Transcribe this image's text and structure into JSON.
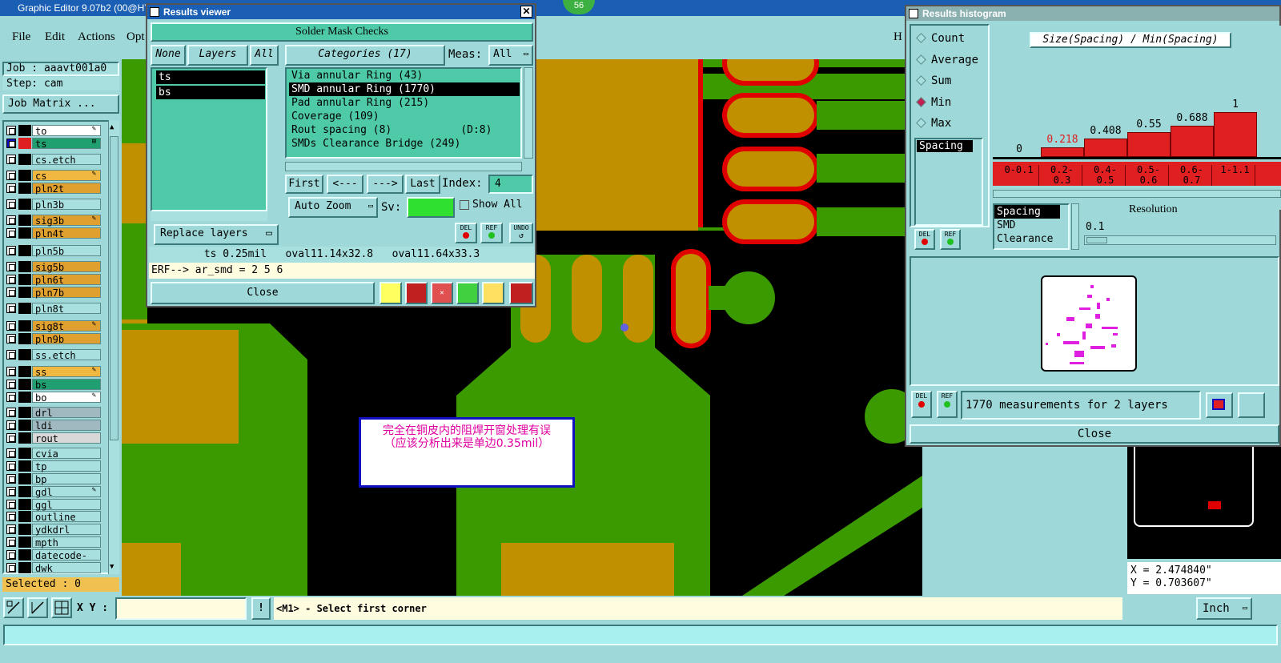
{
  "app": {
    "title": "Graphic Editor 9.07b2 (00@HY",
    "badge": "56"
  },
  "menu": {
    "file": "File",
    "edit": "Edit",
    "actions": "Actions",
    "options": "Opt",
    "help": "H"
  },
  "job": {
    "job_label": "Job : aaavt001a0",
    "step_label": "Step: cam",
    "matrix_button": "Job Matrix ..."
  },
  "layers": [
    {
      "name": "to",
      "color": "#ffffff",
      "mark": "✎"
    },
    {
      "name": "ts",
      "color": "#20a070",
      "mark": "⊞"
    },
    {
      "name": "cs.etch",
      "color": "#a8e0e0",
      "mark": ""
    },
    {
      "name": "cs",
      "color": "#f0b840",
      "mark": "✎"
    },
    {
      "name": "pln2t",
      "color": "#e0a030",
      "mark": ""
    },
    {
      "name": "pln3b",
      "color": "#a8e0e0",
      "mark": ""
    },
    {
      "name": "sig3b",
      "color": "#e0a030",
      "mark": "✎"
    },
    {
      "name": "pln4t",
      "color": "#e0a030",
      "mark": ""
    },
    {
      "name": "pln5b",
      "color": "#a8e0e0",
      "mark": ""
    },
    {
      "name": "sig5b",
      "color": "#e0a030",
      "mark": ""
    },
    {
      "name": "pln6t",
      "color": "#e0a030",
      "mark": ""
    },
    {
      "name": "pln7b",
      "color": "#e0a030",
      "mark": ""
    },
    {
      "name": "pln8t",
      "color": "#a8e0e0",
      "mark": ""
    },
    {
      "name": "sig8t",
      "color": "#e0a030",
      "mark": "✎"
    },
    {
      "name": "pln9b",
      "color": "#e0a030",
      "mark": ""
    },
    {
      "name": "ss.etch",
      "color": "#a8e0e0",
      "mark": ""
    },
    {
      "name": "ss",
      "color": "#f0b840",
      "mark": "✎"
    },
    {
      "name": "bs",
      "color": "#20a070",
      "mark": ""
    },
    {
      "name": "bo",
      "color": "#ffffff",
      "mark": "✎"
    },
    {
      "name": "drl",
      "color": "#a0b8c0",
      "mark": ""
    },
    {
      "name": "ldi",
      "color": "#a0b8c0",
      "mark": ""
    },
    {
      "name": "rout",
      "color": "#d8d8d8",
      "mark": ""
    },
    {
      "name": "cvia",
      "color": "#a8e0e0",
      "mark": ""
    },
    {
      "name": "tp",
      "color": "#a8e0e0",
      "mark": ""
    },
    {
      "name": "bp",
      "color": "#a8e0e0",
      "mark": ""
    },
    {
      "name": "gdl",
      "color": "#a8e0e0",
      "mark": "✎"
    },
    {
      "name": "ggl",
      "color": "#a8e0e0",
      "mark": ""
    },
    {
      "name": "outline",
      "color": "#a8e0e0",
      "mark": ""
    },
    {
      "name": "ydkdrl",
      "color": "#a8e0e0",
      "mark": ""
    },
    {
      "name": "mpth",
      "color": "#a8e0e0",
      "mark": ""
    },
    {
      "name": "datecode-pto",
      "color": "#a8e0e0",
      "mark": ""
    },
    {
      "name": "dwk",
      "color": "#a8e0e0",
      "mark": ""
    }
  ],
  "selected_label": "Selected : 0",
  "results_viewer": {
    "title": "Results viewer",
    "header": "Solder Mask Checks",
    "none_btn": "None",
    "layers_btn": "Layers",
    "all_btn": "All",
    "categories_btn": "Categories (17)",
    "meas_label": "Meas:",
    "meas_value": "All",
    "layer_list": [
      "ts",
      "bs"
    ],
    "categories": [
      "Via annular Ring (43)",
      "SMD annular Ring (1770)",
      "Pad annular Ring (215)",
      "Coverage (109)",
      "Rout spacing (8)           (D:8)",
      "SMDs Clearance Bridge (249)"
    ],
    "first_btn": "First",
    "prev_btn": "<---",
    "next_btn": "--->",
    "last_btn": "Last",
    "index_label": "Index:",
    "index_value": "4",
    "autozoom_btn": "Auto Zoom",
    "sv_label": "Sv:",
    "show_all_label": "Show All",
    "replace_btn": "Replace layers",
    "del_label": "DEL",
    "ref_label": "REF",
    "undo_label": "UNDO",
    "status_line": "ts 0.25mil   oval11.14x32.8   oval11.64x33.3",
    "erf_line": "ERF--> ar_smd = 2 5 6",
    "close_btn": "Close"
  },
  "annotation": {
    "line1": "完全在铜皮内的阻焊开窗处理有误",
    "line2": "（应该分析出来是单边0.35mil）"
  },
  "histogram": {
    "title": "Results histogram",
    "modes": [
      "Count",
      "Average",
      "Sum",
      "Min",
      "Max"
    ],
    "selected_mode": "Min",
    "chart_title": "Size(Spacing) / Min(Spacing)",
    "spacing_label": "Spacing",
    "bins": [
      {
        "range": "0-0.1",
        "value": "0",
        "frac": 0
      },
      {
        "range": "0.2-0.3",
        "value": "0.218",
        "frac": 0.218
      },
      {
        "range": "0.4-0.5",
        "value": "0.408",
        "frac": 0.408
      },
      {
        "range": "0.5-0.6",
        "value": "0.55",
        "frac": 0.55
      },
      {
        "range": "0.6-0.7",
        "value": "0.688",
        "frac": 0.688
      },
      {
        "range": "1-1.1",
        "value": "1",
        "frac": 1
      }
    ],
    "filters": [
      "Spacing",
      "SMD",
      "Clearance"
    ],
    "resolution_label": "Resolution",
    "resolution_value": "0.1",
    "measurements_text": "1770 measurements for 2 layers",
    "close_btn": "Close",
    "del_label": "DEL",
    "ref_label": "REF"
  },
  "coords": {
    "x": "X = 2.474840\"",
    "y": "Y = 0.703607\""
  },
  "bottom": {
    "xy_label": "X Y :",
    "xy_value": "",
    "prompt": "<M1> - Select first corner",
    "units": "Inch"
  }
}
